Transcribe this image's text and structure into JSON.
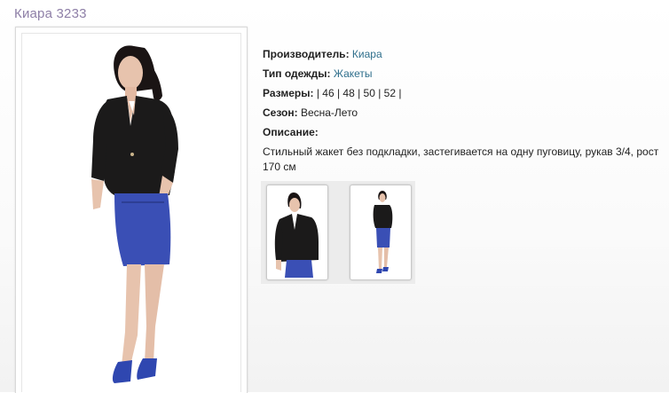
{
  "product": {
    "title": "Киара 3233"
  },
  "details": {
    "manufacturer_label": "Производитель:",
    "manufacturer_value": "Киара",
    "type_label": "Тип одежды:",
    "type_value": "Жакеты",
    "sizes_label": "Размеры:",
    "sizes_value": "| 46 | 48 | 50 | 52 |",
    "season_label": "Сезон:",
    "season_value": "Весна-Лето",
    "description_label": "Описание:",
    "description_text": "Стильный  жакет без подкладки, застегивается на одну пуговицу, рукав 3/4, рост 170 см"
  },
  "colors": {
    "title": "#8e7fa7",
    "link": "#2f6f8c",
    "jacket": "#1b1a1a",
    "skirt": "#3a4fb5",
    "skin": "#e7c3ad"
  },
  "images": {
    "main": "model-photo-jacket-skirt",
    "thumbnails": [
      "thumbnail-closeup",
      "thumbnail-full-length"
    ]
  }
}
